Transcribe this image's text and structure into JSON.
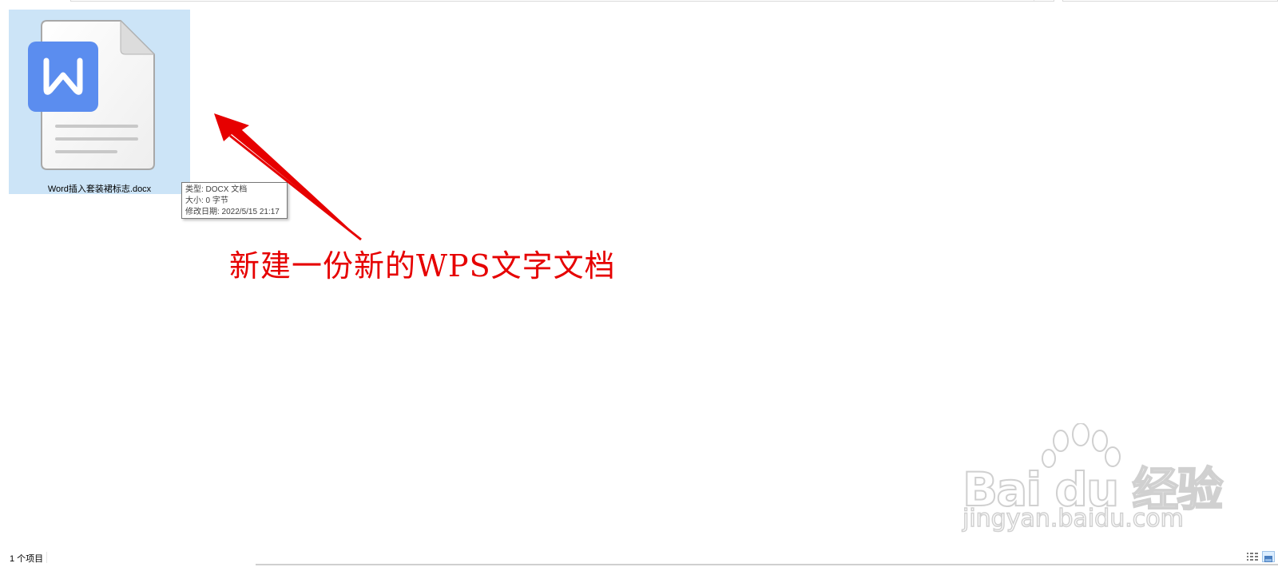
{
  "file": {
    "name": "Word插入套装裙标志.docx",
    "icon": "wps-writer-doc-icon",
    "badge_letter": "W",
    "badge_color": "#5b8def",
    "selected_color": "#cce4f7"
  },
  "tooltip": {
    "type": "类型: DOCX 文档",
    "size": "大小: 0 字节",
    "modified": "修改日期: 2022/5/15 21:17"
  },
  "annotation": {
    "text": "新建一份新的WPS文字文档",
    "color": "#e60000"
  },
  "watermark": {
    "brand": "Bai du 经验",
    "url": "jingyan.baidu.com"
  },
  "status_bar": {
    "item_count": "1 个项目",
    "views": [
      "details-view-icon",
      "large-icons-view-icon"
    ]
  }
}
